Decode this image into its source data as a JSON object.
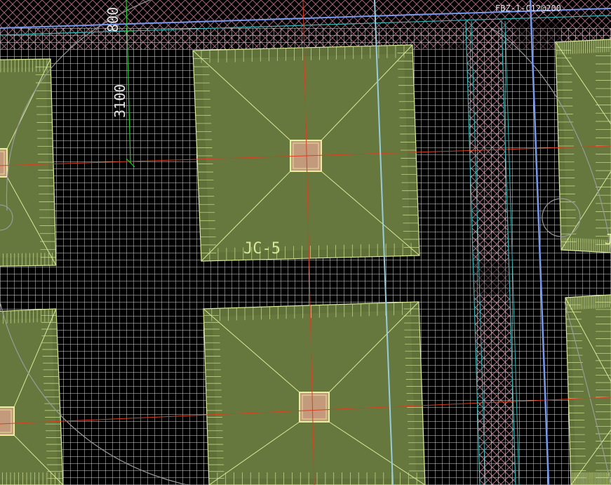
{
  "app": {
    "view": "foundation plan 3D view"
  },
  "labels": {
    "dim_top": "800",
    "dim_vertical": "3100",
    "footing_name": "JC-5",
    "rebar_note": "FBZ-1-C12@200",
    "footing_partial": "J"
  },
  "colors": {
    "background": "#000000",
    "grid_line": "#e8e8e8",
    "footing_fill": "#5f7139",
    "footing_light": "#6b7d42",
    "footing_edge": "#d8e89a",
    "column_fill": "#c49a7c",
    "column_edge": "#e8f0a0",
    "axis_red": "#d84020",
    "axis_blue": "#7799ee",
    "axis_lightblue": "#99ccdd",
    "axis_cyan": "#33bbbb",
    "rebar_pink": "#b07088",
    "dim_green": "#22cc33",
    "arc_gray": "#9a9a9a"
  }
}
